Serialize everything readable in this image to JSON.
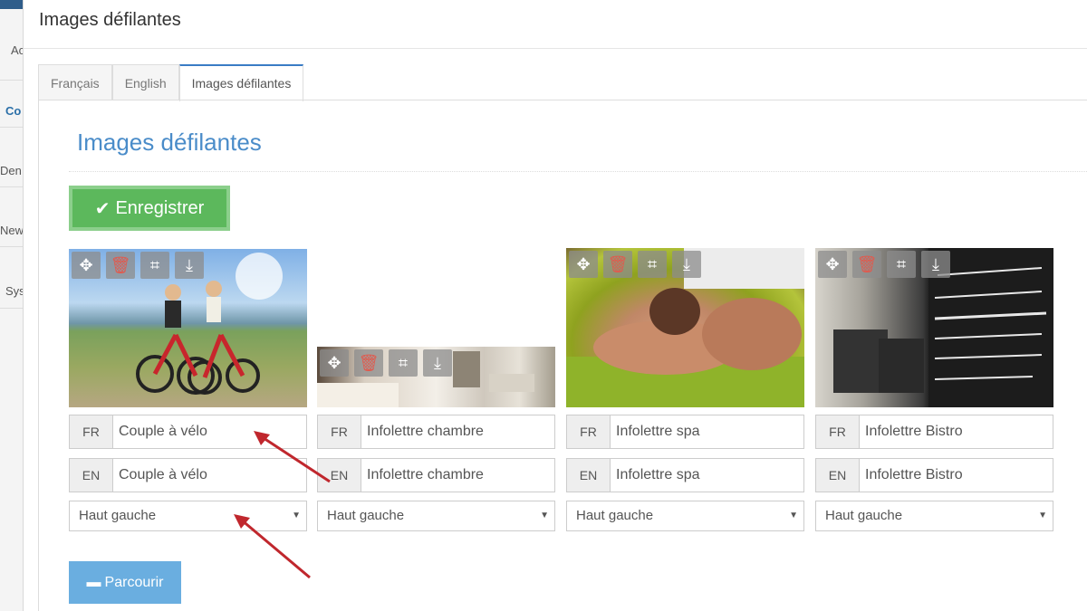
{
  "modal": {
    "title": "Images défilantes"
  },
  "tabs": [
    {
      "label": "Français",
      "active": false
    },
    {
      "label": "English",
      "active": false
    },
    {
      "label": "Images défilantes",
      "active": true
    }
  ],
  "section": {
    "title": "Images défilantes"
  },
  "save_button": {
    "label": "Enregistrer",
    "icon": "check-icon"
  },
  "browse_button": {
    "label": "Parcourir",
    "icon": "folder-icon"
  },
  "background_menu": [
    "Ac",
    "Co",
    "Den",
    "New",
    "Sys"
  ],
  "image_tools": [
    "move-icon",
    "trash-icon",
    "crop-icon",
    "download-icon"
  ],
  "cards": [
    {
      "image": "Couple à vélo",
      "fr_label": "FR",
      "fr_value": "Couple à vélo",
      "en_label": "EN",
      "en_value": "Couple à vélo",
      "position": "Haut gauche"
    },
    {
      "image": "Infolettre chambre",
      "fr_label": "FR",
      "fr_value": "Infolettre chambre",
      "en_label": "EN",
      "en_value": "Infolettre chambre",
      "position": "Haut gauche"
    },
    {
      "image": "Infolettre spa",
      "fr_label": "FR",
      "fr_value": "Infolettre spa",
      "en_label": "EN",
      "en_value": "Infolettre spa",
      "position": "Haut gauche"
    },
    {
      "image": "Infolettre Bistro",
      "fr_label": "FR",
      "fr_value": "Infolettre Bistro",
      "en_label": "EN",
      "en_value": "Infolettre Bistro",
      "position": "Haut gauche"
    }
  ],
  "colors": {
    "save": "#5cb85c",
    "browse": "#6aaee0",
    "title": "#4a8cc9",
    "annotation_arrow": "#c0272d"
  }
}
